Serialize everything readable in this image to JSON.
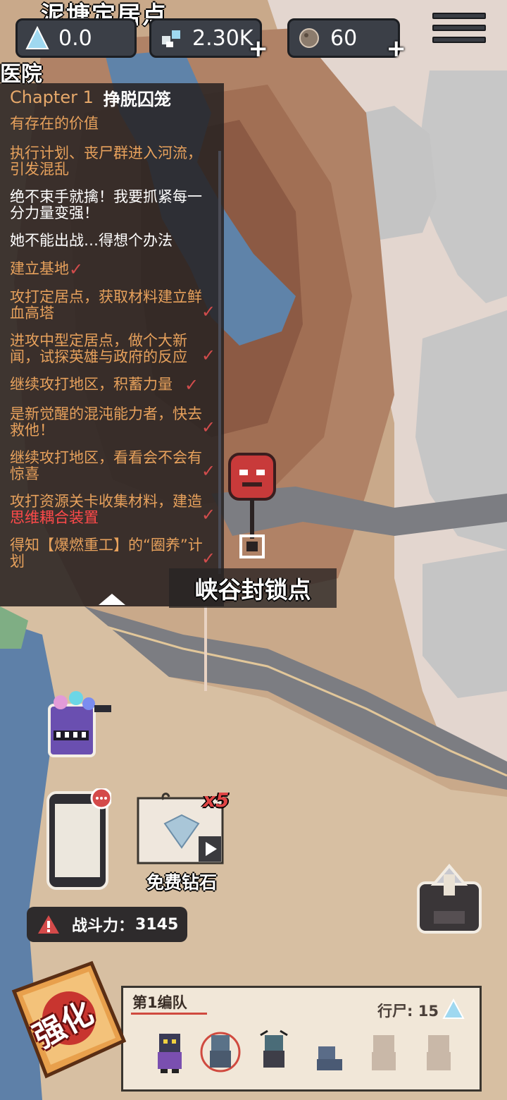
{
  "header": {
    "place_title": "泥塘定居点",
    "place_sub": "医院",
    "resources": [
      {
        "icon": "crystal-icon",
        "value": "0.0",
        "has_plus": false
      },
      {
        "icon": "parts-icon",
        "value": "2.30K",
        "has_plus": true
      },
      {
        "icon": "stone-icon",
        "value": "60",
        "has_plus": true
      }
    ],
    "menu_icon": "hamburger-menu-icon"
  },
  "quests": {
    "chapter_num": "Chapter 1",
    "chapter_name": "挣脱囚笼",
    "items": [
      {
        "text": "有存在的价值",
        "status": "done"
      },
      {
        "text": "执行计划、丧尸群进入河流，引发混乱",
        "status": "done"
      },
      {
        "text": "绝不束手就擒！我要抓紧每一分力量变强！",
        "status": "current"
      },
      {
        "text": "她不能出战…得想个办法",
        "status": "current"
      },
      {
        "text": "建立基地",
        "status": "done"
      },
      {
        "text": "攻打定居点，获取材料建立鲜血高塔",
        "status": "done"
      },
      {
        "text": "进攻中型定居点，做个大新闻，试探英雄与政府的反应",
        "status": "done"
      },
      {
        "text": "继续攻打地区，积蓄力量",
        "status": "done"
      },
      {
        "text": "是新觉醒的混沌能力者，快去救他！",
        "status": "done"
      },
      {
        "text": "继续攻打地区，看看会不会有惊喜",
        "status": "done"
      },
      {
        "text_pre": "攻打资源关卡收集材料，建造",
        "text_hl": "思维耦合装置",
        "status": "done"
      },
      {
        "text": "得知【爆燃重工】的“圈养”计划",
        "status": "done"
      }
    ]
  },
  "map": {
    "node_label": "峡谷封锁点"
  },
  "widgets": {
    "free_diamond": "免费钻石",
    "diamond_multiplier": "x5",
    "power_label": "战斗力：",
    "power_value": "3145"
  },
  "squad": {
    "name": "第1编队",
    "walker_label": "行尸: 15",
    "strengthen": "强化",
    "slots": [
      "filled",
      "filled",
      "filled",
      "filled",
      "locked",
      "locked"
    ]
  },
  "colors": {
    "accent_orange": "#e7a15c",
    "alert_red": "#d24c4c",
    "panel_dark": "#262222"
  }
}
